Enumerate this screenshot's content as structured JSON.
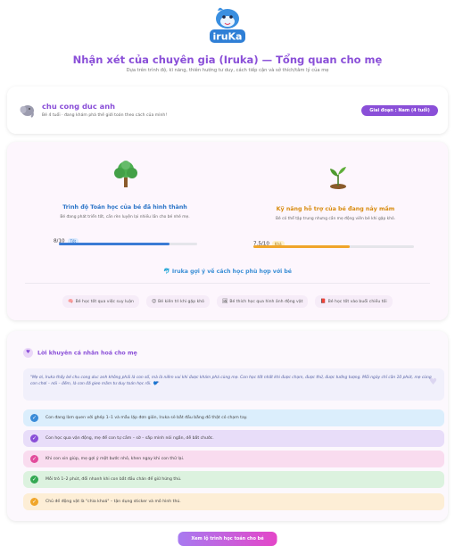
{
  "logo_text": "iruKa",
  "header": {
    "title": "Nhận xét của chuyên gia (Iruka) — Tổng quan cho mẹ",
    "subtitle": "Dựa trên trình độ, kĩ năng, thiên hướng tư duy, cách tiếp cận và sở thích/tâm lý của mẹ"
  },
  "profile": {
    "avatar_icon": "elephant-icon",
    "name": "chu cong duc anh",
    "description": "Bé 4 tuổi · đang khám phá thế giới toán theo cách của mình!",
    "age_button": "Giai đoạn : Nam (4 tuổi)"
  },
  "skills": {
    "left": {
      "icon": "tree-icon",
      "title": "Trình độ Toán học của bé đã hình thành",
      "desc": "Bé đang phát triển tốt, cần rèn luyện lại nhiều lần cho bé nhé mẹ.",
      "score": "8/10",
      "badge": "Tốt",
      "progress": 0.8
    },
    "right": {
      "icon": "sprout-icon",
      "title": "Kỹ năng hỗ trợ của bé đang nảy mầm",
      "desc": "Bé có thể tập trung nhưng cần mẹ động viên bé khi gặp khó.",
      "score": "7.5/10",
      "badge": "Khá",
      "progress": 0.6
    },
    "suggest_title": "Iruka gợi ý về cách học phù hợp với bé",
    "tags": [
      {
        "icon": "brain-icon",
        "label": "Bé học tốt qua việc suy luận"
      },
      {
        "icon": "smile-icon",
        "label": "Bé kiên trì khi gặp khó"
      },
      {
        "icon": "image-icon",
        "label": "Bé thích học qua hình ảnh động vật"
      },
      {
        "icon": "book-icon",
        "label": "Bé học tốt vào buổi chiều tối"
      }
    ]
  },
  "advice": {
    "title": "Lời khuyên cá nhân hoá cho mẹ",
    "quote": "\"Mẹ ơi, Iruka thấy bé chu cong duc anh không phải là con số, mà là niềm vui khi được khám phá cùng mẹ. Con học tốt nhất khi được chạm, được thử, được tưởng tượng. Mỗi ngày chỉ cần 10 phút, mẹ cùng con chơi – nói – đếm, là con đã gieo mầm tư duy toán học rồi. 💙\"",
    "tips": [
      "Con đang làm quen với ghép 1–1 và mẫu lặp đơn giản, Iruka sẽ bắt đầu bằng đồ thật có chạm tay.",
      "Con học qua vận động, mẹ để con tự cầm – sờ – sắp mình nói ngắn, dễ bắt chước.",
      "Khi con xin giúp, mẹ gợi ý một bước nhỏ, khen ngay khi con thử lại.",
      "Mỗi trò 1–2 phút, đổi nhanh khi con bắt đầu chán để giữ hứng thú.",
      "Chủ đề động vật là \"chìa khoá\" – tận dụng sticker và mô hình thú."
    ]
  },
  "cta_label": "Xem lộ trình học toán cho bé",
  "colors": {
    "brand_purple": "#8a4fd8",
    "blue": "#2a74c7",
    "orange": "#d88c10"
  }
}
